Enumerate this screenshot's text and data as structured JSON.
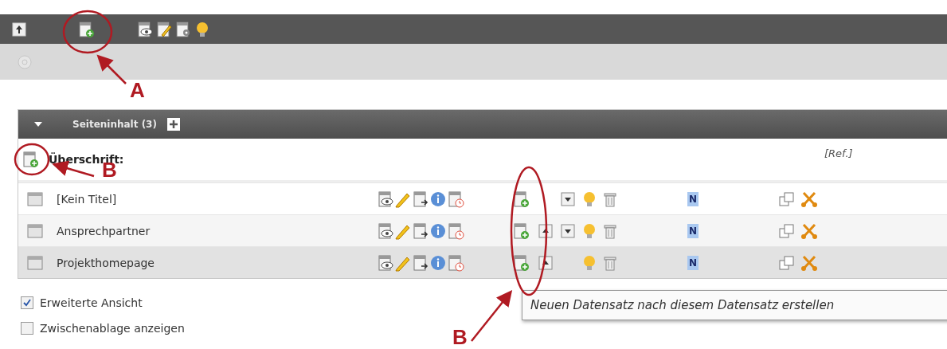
{
  "panel": {
    "title": "Seiteninhalt (3)",
    "expanded": true,
    "header_row": {
      "label": "Überschrift:",
      "ref": "[Ref.]"
    },
    "rows": [
      {
        "title": "[Kein Titel]",
        "can_move_up": false,
        "can_move_down": true,
        "badge": "N",
        "hovered": false
      },
      {
        "title": "Ansprechpartner",
        "can_move_up": true,
        "can_move_down": true,
        "badge": "N",
        "hovered": false
      },
      {
        "title": "Projekthomepage",
        "can_move_up": true,
        "can_move_down": false,
        "badge": "N",
        "hovered": true
      }
    ]
  },
  "tooltip": "Neuen Datensatz nach diesem Datensatz erstellen",
  "options": [
    {
      "label": "Erweiterte Ansicht",
      "checked": true
    },
    {
      "label": "Zwischenablage anzeigen",
      "checked": false
    }
  ],
  "annotations": [
    {
      "label": "A"
    },
    {
      "label": "B"
    },
    {
      "label": "B"
    }
  ]
}
